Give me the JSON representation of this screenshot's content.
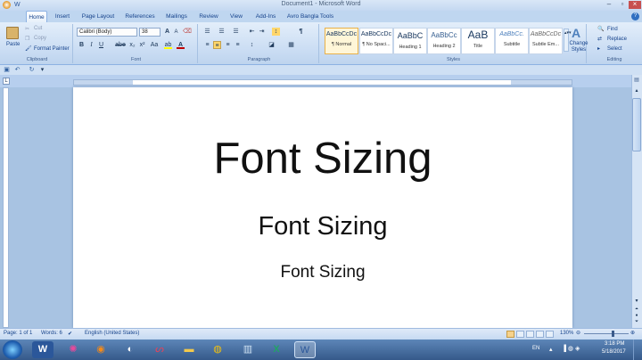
{
  "window": {
    "title": "Document1 - Microsoft Word"
  },
  "tabs": [
    "Home",
    "Insert",
    "Page Layout",
    "References",
    "Mailings",
    "Review",
    "View",
    "Add-Ins",
    "Avro Bangla Tools"
  ],
  "clipboard": {
    "paste": "Paste",
    "cut": "Cut",
    "copy": "Copy",
    "format_painter": "Format Painter",
    "label": "Clipboard"
  },
  "font": {
    "name": "Calibri (Body)",
    "size": "38",
    "label": "Font",
    "bold": "B",
    "italic": "I",
    "underline": "U",
    "strike": "abe",
    "sub": "x₂",
    "sup": "x²",
    "aa": "Aa",
    "grow": "A",
    "shrink": "A"
  },
  "paragraph": {
    "label": "Paragraph",
    "pilcrow": "¶"
  },
  "styles": {
    "label": "Styles",
    "items": [
      {
        "preview": "AaBbCcDc",
        "name": "¶ Normal"
      },
      {
        "preview": "AaBbCcDc",
        "name": "¶ No Spaci..."
      },
      {
        "preview": "AaBbC",
        "name": "Heading 1"
      },
      {
        "preview": "AaBbCc",
        "name": "Heading 2"
      },
      {
        "preview": "AaB",
        "name": "Title"
      },
      {
        "preview": "AaBbCc.",
        "name": "Subtitle"
      },
      {
        "preview": "AaBbCcDc",
        "name": "Subtle Em..."
      }
    ],
    "change_styles": "Change Styles"
  },
  "editing": {
    "label": "Editing",
    "find": "Find",
    "replace": "Replace",
    "select": "Select"
  },
  "document": {
    "lines": [
      "Font Sizing",
      "Font Sizing",
      "Font Sizing"
    ]
  },
  "status": {
    "page": "Page: 1 of 1",
    "words": "Words: 6",
    "language": "English (United States)",
    "zoom": "130%"
  },
  "tray": {
    "lang": "EN",
    "time": "3:18 PM",
    "date": "5/18/2017"
  }
}
